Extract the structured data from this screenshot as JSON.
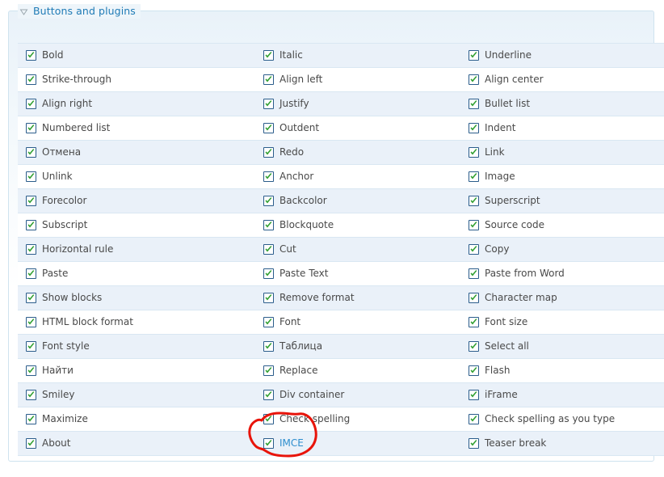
{
  "fieldset": {
    "legend": "Buttons and plugins",
    "toggle_icon": "triangle-down-icon",
    "legend_color": "#1f7bb6",
    "border_color": "#cfe3ef"
  },
  "table": {
    "row_colors": {
      "odd": "#eaf1f9",
      "even": "#ffffff"
    },
    "checkbox": {
      "state": "checked",
      "check_color": "#2f9e2f",
      "border_color": "#2b5d8b",
      "box_color": "#ffffff"
    },
    "rows": [
      {
        "c1": "Bold",
        "c2": "Italic",
        "c3": "Underline"
      },
      {
        "c1": "Strike-through",
        "c2": "Align left",
        "c3": "Align center"
      },
      {
        "c1": "Align right",
        "c2": "Justify",
        "c3": "Bullet list"
      },
      {
        "c1": "Numbered list",
        "c2": "Outdent",
        "c3": "Indent"
      },
      {
        "c1": "Отмена",
        "c2": "Redo",
        "c3": "Link"
      },
      {
        "c1": "Unlink",
        "c2": "Anchor",
        "c3": "Image"
      },
      {
        "c1": "Forecolor",
        "c2": "Backcolor",
        "c3": "Superscript"
      },
      {
        "c1": "Subscript",
        "c2": "Blockquote",
        "c3": "Source code"
      },
      {
        "c1": "Horizontal rule",
        "c2": "Cut",
        "c3": "Copy"
      },
      {
        "c1": "Paste",
        "c2": "Paste Text",
        "c3": "Paste from Word"
      },
      {
        "c1": "Show blocks",
        "c2": "Remove format",
        "c3": "Character map"
      },
      {
        "c1": "HTML block format",
        "c2": "Font",
        "c3": "Font size"
      },
      {
        "c1": "Font style",
        "c2": "Таблица",
        "c3": "Select all"
      },
      {
        "c1": "Найти",
        "c2": "Replace",
        "c3": "Flash"
      },
      {
        "c1": "Smiley",
        "c2": "Div container",
        "c3": "iFrame"
      },
      {
        "c1": "Maximize",
        "c2": "Check spelling",
        "c3": "Check spelling as you type"
      },
      {
        "c1": "About",
        "c2": "IMCE",
        "c3": "Teaser break"
      }
    ],
    "highlighted_label": "IMCE",
    "highlighted_label_color": "#2e8ece"
  },
  "annotation": {
    "shape": "hand-drawn-circle",
    "color": "#e8140a",
    "target": "IMCE"
  }
}
